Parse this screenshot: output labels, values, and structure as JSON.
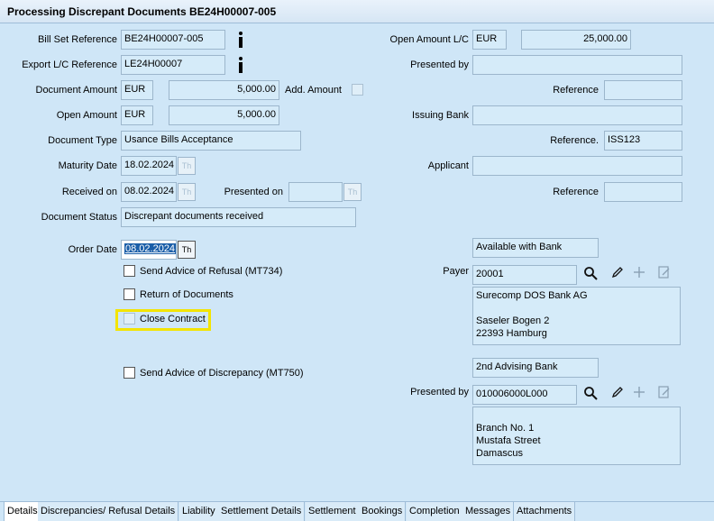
{
  "window": {
    "title": "Processing Discrepant Documents BE24H00007-005"
  },
  "left": {
    "bill_set_reference": {
      "label": "Bill Set Reference",
      "value": "BE24H00007-005"
    },
    "export_lc_reference": {
      "label": "Export L/C Reference",
      "value": "LE24H00007"
    },
    "document_amount": {
      "label": "Document Amount",
      "currency": "EUR",
      "value": "5,000.00"
    },
    "add_amount": {
      "label": "Add. Amount"
    },
    "open_amount": {
      "label": "Open Amount",
      "currency": "EUR",
      "value": "5,000.00"
    },
    "document_type": {
      "label": "Document Type",
      "value": "Usance Bills Acceptance"
    },
    "maturity_date": {
      "label": "Maturity Date",
      "value": "18.02.2024"
    },
    "received_on": {
      "label": "Received on",
      "value": "08.02.2024"
    },
    "presented_on": {
      "label": "Presented on",
      "value": ""
    },
    "document_status": {
      "label": "Document Status",
      "value": "Discrepant documents received"
    },
    "order_date": {
      "label": "Order Date",
      "value": "08.02.2024"
    },
    "checkboxes": {
      "advice_refusal": "Send Advice of Refusal (MT734)",
      "return_documents": "Return of Documents",
      "close_contract": "Close Contract",
      "advice_discrepancy": "Send Advice of Discrepancy (MT750)"
    }
  },
  "right": {
    "open_amount_lc": {
      "label": "Open Amount L/C",
      "currency": "EUR",
      "value": "25,000.00"
    },
    "presented_by_top": {
      "label": "Presented by",
      "value": ""
    },
    "reference_1": {
      "label": "Reference",
      "value": ""
    },
    "issuing_bank": {
      "label": "Issuing Bank",
      "value": ""
    },
    "reference_2": {
      "label": "Reference.",
      "value": "ISS123"
    },
    "applicant": {
      "label": "Applicant",
      "value": ""
    },
    "reference_3": {
      "label": "Reference",
      "value": ""
    },
    "available_with": {
      "value": "Available with Bank"
    },
    "payer": {
      "label": "Payer",
      "value": "20001",
      "address": "Surecomp DOS Bank AG\n\nSaseler Bogen 2\n22393 Hamburg"
    },
    "advising_bank": {
      "value": "2nd Advising Bank"
    },
    "presented_by": {
      "label": "Presented by",
      "value": "010006000L000",
      "address": "\nBranch No. 1\nMustafa Street\nDamascus"
    }
  },
  "icons": {
    "info": "info-icon",
    "calendar": "calendar-icon",
    "search": "search-icon",
    "edit": "pencil-icon",
    "add": "plus-icon",
    "notes": "notes-icon"
  },
  "tabs": [
    "Details",
    "Discrepancies/ Refusal Details",
    "Liability",
    "Settlement Details",
    "Settlement",
    "Bookings",
    "Completion",
    "Messages",
    "Attachments"
  ],
  "calendar_glyph": "Th",
  "highlight_color": "#f3e400"
}
